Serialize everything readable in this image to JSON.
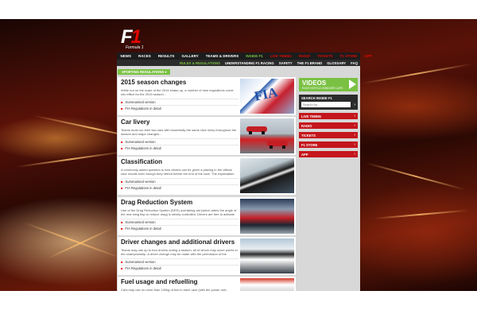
{
  "logo": {
    "mark_f": "F",
    "mark_1": "1",
    "subtitle": "Formula 1"
  },
  "nav": {
    "items": [
      {
        "label": "NEWS",
        "state": "normal"
      },
      {
        "label": "RACES",
        "state": "normal"
      },
      {
        "label": "RESULTS",
        "state": "normal"
      },
      {
        "label": "GALLERY",
        "state": "normal"
      },
      {
        "label": "TEAMS & DRIVERS",
        "state": "normal"
      },
      {
        "label": "INSIDE F1",
        "state": "active"
      },
      {
        "label": "LIVE TIMING",
        "state": "red"
      },
      {
        "label": "RADIO",
        "state": "red"
      },
      {
        "label": "TICKETS",
        "state": "red"
      },
      {
        "label": "F1 STORE",
        "state": "red"
      },
      {
        "label": "APP",
        "state": "red"
      }
    ]
  },
  "subnav": {
    "items": [
      {
        "label": "RULES & REGULATIONS",
        "state": "active"
      },
      {
        "label": "UNDERSTANDING F1 RACING",
        "state": "normal"
      },
      {
        "label": "SAFETY",
        "state": "normal"
      },
      {
        "label": "THE F1 BRAND",
        "state": "normal"
      },
      {
        "label": "GLOSSARY",
        "state": "normal"
      },
      {
        "label": "FAQ",
        "state": "normal"
      }
    ]
  },
  "filter": {
    "label": "SPORTING REGULATIONS ▾"
  },
  "articles": [
    {
      "title": "2015 season changes",
      "summary": "While not on the scale of the 2014 shake-up, a number of new regulations come into effect for the 2015 season...",
      "link1": "Summarised version",
      "link2": "FIA Regulations in detail",
      "thumb": "fia-flag"
    },
    {
      "title": "Car livery",
      "summary": "Teams must run their two cars with essentially the same race livery throughout the season and major changes...",
      "link1": "Summarised version",
      "link2": "FIA Regulations in detail",
      "thumb": "red-cars"
    },
    {
      "title": "Classification",
      "summary": "A commonly asked question is how drivers can be given a placing in the official race results even though they retired before the end of the race. The explanation can be found within the FIA...",
      "link1": "Summarised version",
      "link2": "FIA Regulations in detail",
      "thumb": "chequered-flag"
    },
    {
      "title": "Drag Reduction System",
      "summary": "Use of the Drag Reduction System (DRS) overtaking aid (which alters the angle of the rear wing flap to reduce drag) is strictly controlled. Drivers are free to activate the DRS ad they wish within the...",
      "link1": "Summarised version",
      "link2": "FIA Regulations in detail",
      "thumb": "drs-car"
    },
    {
      "title": "Driver changes and additional drivers",
      "summary": "Teams may use up to four drivers during a season, all of whom may score points in the championship. A driver change may be made with the permission of the stewards any time before the start of...",
      "link1": "Summarised version",
      "link2": "FIA Regulations in detail",
      "thumb": "drivers-group"
    },
    {
      "title": "Fuel usage and refuelling",
      "summary": "Cars may use no more than 100kg of fuel in each race (with the power unit...",
      "link1": "",
      "link2": "",
      "thumb": "fuel"
    }
  ],
  "sidebar": {
    "videos_title": "VIDEOS",
    "videos_subtitle": "RACE EDITS & ONBOARD LAPS",
    "search_title": "SEARCH INSIDE F1",
    "search_placeholder": "Search for...",
    "search_go": "›",
    "buttons": [
      "LIVE TIMING",
      "RADIO",
      "TICKETS",
      "F1 STORE",
      "APP"
    ]
  },
  "colors": {
    "accent_green": "#7ac143",
    "f1_red": "#e10600",
    "nav_dark": "#1c1c1c"
  }
}
